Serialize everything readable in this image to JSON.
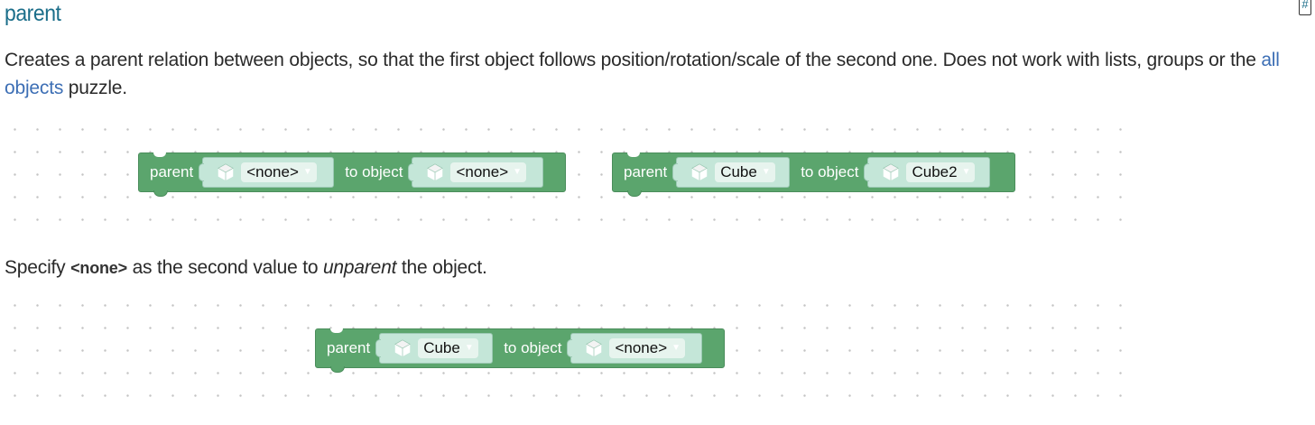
{
  "heading": {
    "title": "parent",
    "anchor": "#"
  },
  "description": {
    "text_before_link": "Creates a parent relation between objects, so that the first object follows position/rotation/scale of the second one. Does not work with lists, groups or the ",
    "link_text": "all objects",
    "text_after_link": " puzzle."
  },
  "note": {
    "prefix": "Specify ",
    "code": "<none>",
    "middle": " as the second value to ",
    "emphasis": "unparent",
    "suffix": " the object."
  },
  "blocks": {
    "block1": {
      "label": "parent",
      "first_value": "<none>",
      "connector": "to object",
      "second_value": "<none>"
    },
    "block2": {
      "label": "parent",
      "first_value": "Cube",
      "connector": "to object",
      "second_value": "Cube2"
    },
    "block3": {
      "label": "parent",
      "first_value": "Cube",
      "connector": "to object",
      "second_value": "<none>"
    }
  },
  "colors": {
    "block_green": "#5ba56d",
    "socket": "#c4e6d8",
    "heading": "#1b6e8a",
    "link": "#3d6fb5"
  },
  "icons": {
    "object_icon": "cube-icon",
    "dropdown_icon": "triangle-down-icon"
  }
}
